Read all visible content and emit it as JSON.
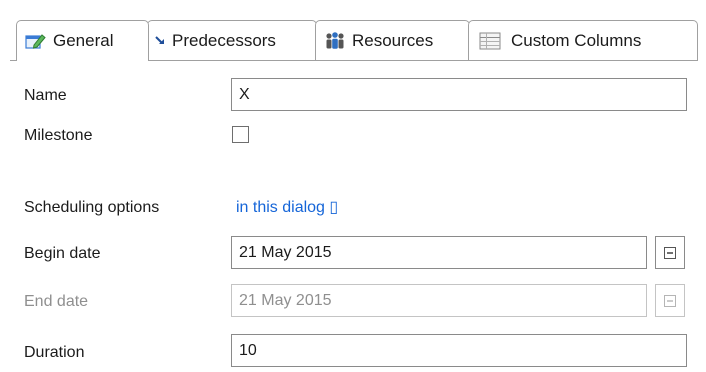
{
  "tabs": [
    {
      "label": "General",
      "icon": "edit-task-icon",
      "active": true
    },
    {
      "label": "Predecessors",
      "icon": "predecessor-arrow-icon",
      "active": false
    },
    {
      "label": "Resources",
      "icon": "people-icon",
      "active": false
    },
    {
      "label": "Custom Columns",
      "icon": "table-icon",
      "active": false
    }
  ],
  "form": {
    "name": {
      "label": "Name",
      "value": "X"
    },
    "milestone": {
      "label": "Milestone",
      "checked": false
    },
    "scheduling": {
      "label": "Scheduling options",
      "link": "in this dialog ▯"
    },
    "begin_date": {
      "label": "Begin date",
      "value": "21 May 2015"
    },
    "end_date": {
      "label": "End date",
      "value": "21 May 2015",
      "disabled": true
    },
    "duration": {
      "label": "Duration",
      "value": "10"
    }
  },
  "colors": {
    "link": "#1565d8",
    "disabled_text": "#8f8f8f",
    "border": "#8a8a8a"
  }
}
